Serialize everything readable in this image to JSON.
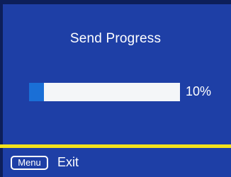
{
  "dialog": {
    "title": "Send Progress",
    "progress_fraction": 0.1,
    "progress_text": "10%"
  },
  "footer": {
    "menu_key_label": "Menu",
    "exit_label": "Exit"
  },
  "colors": {
    "background": "#1e3fa6",
    "progress_fill": "#1a6fd6",
    "progress_track": "#f4f6f8",
    "divider": "#f2e21a",
    "text": "#ffffff"
  }
}
